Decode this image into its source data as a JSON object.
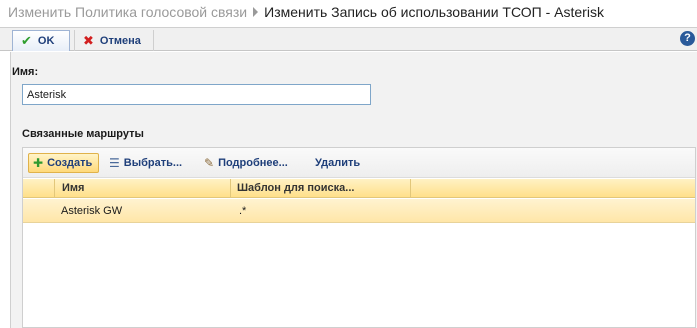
{
  "breadcrumb": {
    "parent": "Изменить Политика голосовой связи",
    "current": "Изменить Запись об использовании ТСОП - Asterisk"
  },
  "toolbar": {
    "ok_label": "OK",
    "cancel_label": "Отмена",
    "help_icon": "?"
  },
  "form": {
    "name_label": "Имя:",
    "name_value": "Asterisk",
    "routes_label": "Связанные маршруты"
  },
  "routes_toolbar": {
    "create_label": "Создать",
    "select_label": "Выбрать...",
    "details_label": "Подробнее...",
    "delete_label": "Удалить"
  },
  "routes_table": {
    "columns": [
      "Имя",
      "Шаблон для поиска..."
    ],
    "rows": [
      {
        "name": "Asterisk GW",
        "pattern": ".*"
      }
    ]
  },
  "colors": {
    "accent": "#1f3f7a",
    "selection": "#ffe6a8",
    "header": "#ffe08a"
  }
}
